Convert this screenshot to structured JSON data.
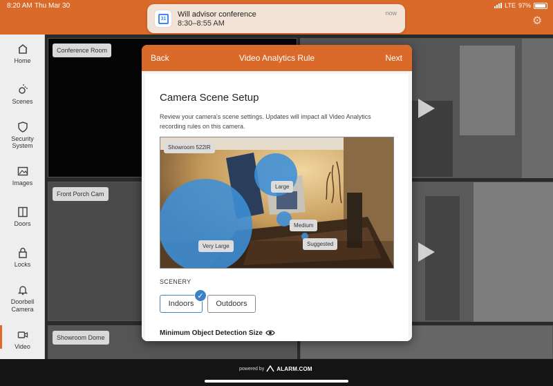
{
  "status": {
    "time": "8:20 AM",
    "date": "Thu Mar 30",
    "carrier": "LTE",
    "battery": "97%"
  },
  "notification": {
    "app_icon_text": "31",
    "title": "Will advisor conference",
    "subtitle": "8:30–8:55 AM",
    "time": "now"
  },
  "sidebar": {
    "items": [
      {
        "label": "Home",
        "icon": "home-icon"
      },
      {
        "label": "Scenes",
        "icon": "scenes-icon"
      },
      {
        "label": "Security System",
        "icon": "shield-icon"
      },
      {
        "label": "Images",
        "icon": "image-icon"
      },
      {
        "label": "Doors",
        "icon": "door-icon"
      },
      {
        "label": "Locks",
        "icon": "lock-icon"
      },
      {
        "label": "Doorbell Camera",
        "icon": "bell-icon"
      },
      {
        "label": "Video",
        "icon": "video-icon"
      }
    ],
    "active": "Video"
  },
  "cameras": {
    "conference_room": "Conference Room",
    "front_porch": "Front Porch Cam",
    "showroom_dome": "Showroom Dome"
  },
  "modal": {
    "back": "Back",
    "title": "Video Analytics Rule",
    "next": "Next",
    "heading": "Camera Scene Setup",
    "description": "Review your camera's scene settings. Updates will impact all Video Analytics recording rules on this camera.",
    "camera_name": "Showroom 522IR",
    "sizes": {
      "large": "Large",
      "medium": "Medium",
      "suggested": "Suggested",
      "very_large": "Very Large"
    },
    "scenery_label": "SCENERY",
    "options": {
      "indoors": "Indoors",
      "outdoors": "Outdoors",
      "selected": "Indoors"
    },
    "min_size_label": "Minimum Object Detection Size"
  },
  "footer": {
    "powered_by": "powered by",
    "brand": "ALARM.COM"
  },
  "colors": {
    "accent": "#d96a2a",
    "selection_blue": "#3c82c4"
  }
}
